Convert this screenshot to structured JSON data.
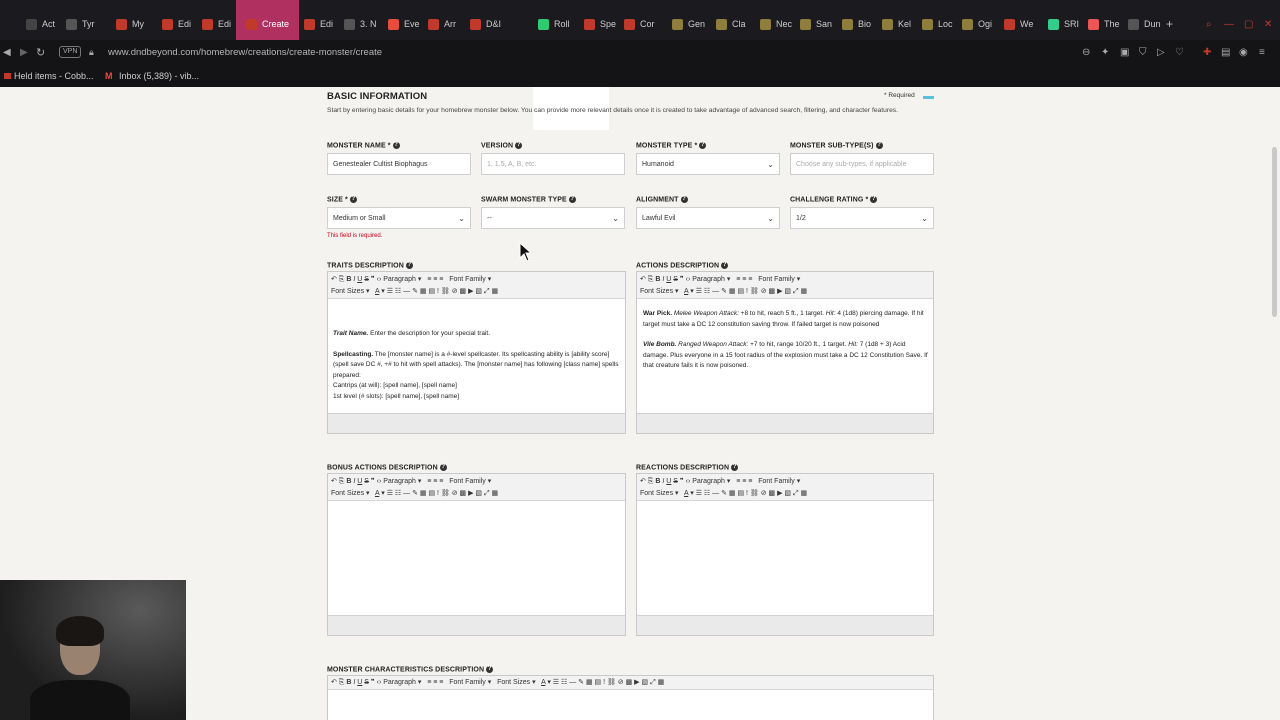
{
  "browser": {
    "tabs": [
      {
        "label": "Act",
        "color": "#444"
      },
      {
        "label": "Tyr",
        "color": "#555"
      },
      {
        "label": "My",
        "color": "#c0392b"
      },
      {
        "label": "Edi",
        "color": "#c0392b"
      },
      {
        "label": "Edi",
        "color": "#c0392b"
      },
      {
        "label": "Create",
        "color": "#c0392b"
      },
      {
        "label": "Edi",
        "color": "#c0392b"
      },
      {
        "label": "3. N",
        "color": "#555"
      },
      {
        "label": "Eve",
        "color": "#e74c3c"
      },
      {
        "label": "Arr",
        "color": "#c0392b"
      },
      {
        "label": "D&I",
        "color": "#c0392b"
      },
      {
        "label": "Roll",
        "color": "#2ecc71"
      },
      {
        "label": "Spe",
        "color": "#c0392b"
      },
      {
        "label": "Cor",
        "color": "#c0392b"
      },
      {
        "label": "Gen",
        "color": "#8e7d3b"
      },
      {
        "label": "Cla",
        "color": "#8e7d3b"
      },
      {
        "label": "Nec",
        "color": "#8e7d3b"
      },
      {
        "label": "San",
        "color": "#8e7d3b"
      },
      {
        "label": "Bio",
        "color": "#8e7d3b"
      },
      {
        "label": "Kel",
        "color": "#8e7d3b"
      },
      {
        "label": "Loc",
        "color": "#8e7d3b"
      },
      {
        "label": "Ogi",
        "color": "#8e7d3b"
      },
      {
        "label": "We",
        "color": "#c0392b"
      },
      {
        "label": "SRI",
        "color": "#3c8"
      },
      {
        "label": "The",
        "color": "#e55"
      },
      {
        "label": "Dun",
        "color": "#555"
      }
    ],
    "url": "www.dndbeyond.com/homebrew/creations/create-monster/create",
    "vpn": "VPN",
    "bookmarks": [
      "Held items - Cobb...",
      "Inbox (5,389) - vib..."
    ]
  },
  "form": {
    "section_title": "BASIC INFORMATION",
    "required_note": "* Required",
    "intro": "Start by entering basic details for your homebrew monster below. You can provide more relevant details once it is created to take advantage of advanced search, filtering, and character features.",
    "monster_name": {
      "label": "MONSTER NAME *",
      "value": "Genestealer Cultist Biophagus"
    },
    "version": {
      "label": "VERSION",
      "placeholder": "1, 1.5, A, B, etc."
    },
    "monster_type": {
      "label": "MONSTER TYPE *",
      "value": "Humanoid"
    },
    "monster_subtype": {
      "label": "MONSTER SUB-TYPE(S)",
      "placeholder": "Choose any sub-types, if applicable"
    },
    "size": {
      "label": "SIZE *",
      "value": "Medium or Small",
      "error": "This field is required."
    },
    "swarm_type": {
      "label": "SWARM MONSTER TYPE",
      "value": "--"
    },
    "alignment": {
      "label": "ALIGNMENT",
      "value": "Lawful Evil"
    },
    "challenge_rating": {
      "label": "CHALLENGE RATING *",
      "value": "1/2"
    }
  },
  "editor_toolbar": {
    "paragraph": "Paragraph",
    "font_family": "Font Family",
    "font_sizes": "Font Sizes"
  },
  "editors": {
    "traits": {
      "label": "TRAITS DESCRIPTION",
      "p1_bold": "Trait Name.",
      "p1_text": " Enter the description for your special trait.",
      "p2_bold": "Spellcasting.",
      "p2_text": " The [monster name] is a #-level spellcaster. Its spellcasting ability is [ability score] (spell save DC #, +# to hit with spell attacks). The [monster name] has following [class name] spells prepared:",
      "p2_line1": "Cantrips (at will): [spell name], [spell name]",
      "p2_line2": "1st level (# slots): [spell name], [spell name]"
    },
    "actions": {
      "label": "ACTIONS DESCRIPTION",
      "a1_bold": "War Pick.",
      "a1_italic": " Melee Weapon Attack:",
      "a1_text1": " +8 to hit, reach 5 ft., 1 target. ",
      "a1_hit": "Hit:",
      "a1_text2": " 4 (1d8) piercing damage. If hit target must take a DC 12 constitution saving throw. If failed target is now poisoned",
      "a2_bold": "Vile Bomb.",
      "a2_italic": " Ranged Weapon Attack:",
      "a2_text1": " +7 to hit, range 10/20 ft., 1 target. ",
      "a2_hit": "Hit:",
      "a2_text2": " 7 (1d8 + 3) Acid damage. Plus everyone in a 15 foot radius of the explosion must take a DC 12 Constitution Save. If that creature fails it is now poisoned."
    },
    "bonus_actions": {
      "label": "BONUS ACTIONS DESCRIPTION"
    },
    "reactions": {
      "label": "REACTIONS DESCRIPTION"
    },
    "characteristics": {
      "label": "MONSTER CHARACTERISTICS DESCRIPTION"
    }
  }
}
